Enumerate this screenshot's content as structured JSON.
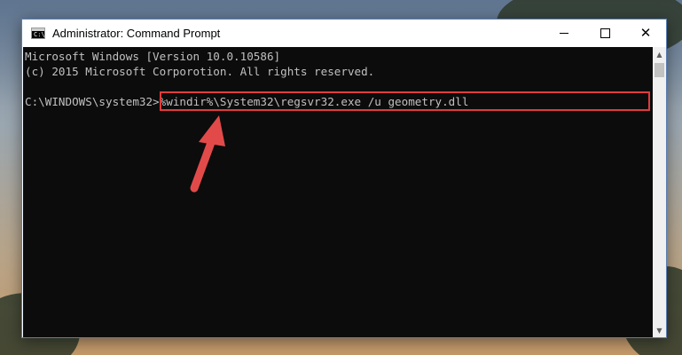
{
  "window": {
    "title": "Administrator: Command Prompt",
    "controls": {
      "minimize_icon": "minimize-icon",
      "maximize_icon": "maximize-icon",
      "close_icon": "close-icon"
    }
  },
  "console": {
    "line1": "Microsoft Windows [Version 10.0.10586]",
    "line2": "(c) 2015 Microsoft Corporotion. All rights reserved.",
    "prompt": "C:\\WINDOWS\\system32>",
    "command": "%windir%\\System32\\regsvr32.exe /u geometry.dll"
  },
  "annotation": {
    "highlight_color": "#e03c3c",
    "arrow_color": "#e24a4a"
  }
}
